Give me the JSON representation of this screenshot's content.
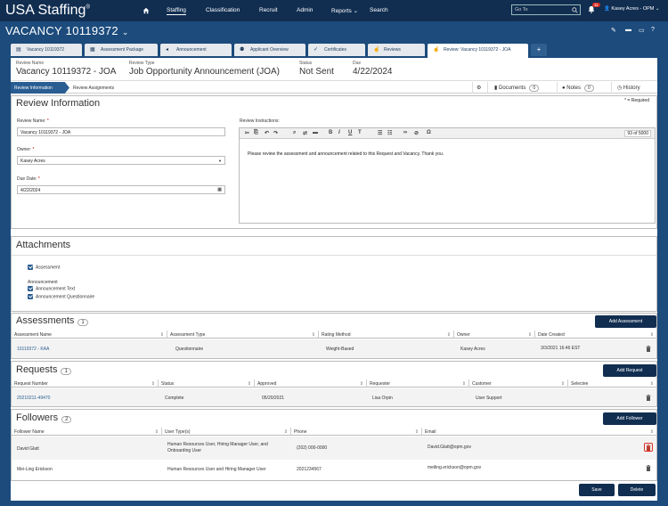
{
  "nav": {
    "logo": "USA Staffing",
    "items": [
      "Staffing",
      "Classification",
      "Recruit",
      "Admin",
      "Reports",
      "Search"
    ],
    "goto_placeholder": "Go To",
    "notif_count": "11",
    "user": "Kasey Acres - OPM"
  },
  "vacancy_title": "VACANCY 10119372",
  "tabs": [
    "Vacancy 10119372",
    "Assessment Package",
    "Announcement",
    "Applicant Overview",
    "Certificates",
    "Reviews",
    "Review: Vacancy 10119372 - JOA"
  ],
  "header": {
    "review_name_label": "Review Name",
    "review_name": "Vacancy 10119372 - JOA",
    "review_type_label": "Review Type",
    "review_type": "Job Opportunity Announcement (JOA)",
    "status_label": "Status",
    "status": "Not Sent",
    "due_label": "Due",
    "due": "4/22/2024"
  },
  "subtabs": {
    "info": "Review Information",
    "assign": "Review Assignments"
  },
  "actions": {
    "documents": "Documents",
    "documents_count": "0",
    "notes": "Notes",
    "notes_count": "0",
    "history": "History"
  },
  "review_info": {
    "title": "Review Information",
    "required_note": "* = Required",
    "name_label": "Review Name:",
    "name_value": "Vacancy 10119372 - JOA",
    "owner_label": "Owner:",
    "owner_value": "Kasey Acres",
    "due_label": "Due Date:",
    "due_value": "4/22/2024",
    "instructions_label": "Review Instructions:",
    "instructions_text": "Please review the assessment and announcement related to this Request and Vacancy. Thank you.",
    "char_count": "93 of 5000"
  },
  "attachments": {
    "title": "Attachments",
    "assessment": "Assessment",
    "announcement_group": "Announcement",
    "announcement_text": "Announcement Text",
    "announcement_q": "Announcement Questionnaire"
  },
  "assessments": {
    "title": "Assessments",
    "count": "1",
    "add": "Add Assessment",
    "columns": [
      "Assessment Name",
      "Assessment Type",
      "Rating Method",
      "Owner",
      "Date Created"
    ],
    "rows": [
      [
        "10119372 - KAA",
        "Questionnaire",
        "Weight-Based",
        "Kasey Acres",
        "3/3/2021 16:46 EST"
      ]
    ]
  },
  "requests": {
    "title": "Requests",
    "count": "1",
    "add": "Add Request",
    "columns": [
      "Request Number",
      "Status",
      "Approved",
      "Requester",
      "Customer",
      "Selectee"
    ],
    "rows": [
      [
        "20210211-49470",
        "Complete",
        "05/20/2021",
        "Lisa Orpin",
        "User Support",
        ""
      ]
    ]
  },
  "followers": {
    "title": "Followers",
    "count": "2",
    "add": "Add Follower",
    "columns": [
      "Follower Name",
      "User Type(s)",
      "Phone",
      "Email"
    ],
    "rows": [
      [
        "David Glatt",
        "Human Resources User, Hiring Manager User, and Onboarding User",
        "(202) 000-0000",
        "David.Glatt@opm.gov"
      ],
      [
        "Mei-Ling Erickson",
        "Human Resources User and Hiring Manager User",
        "2021234567",
        "meiling.erickson@opm.gov"
      ]
    ]
  },
  "footer": {
    "save": "Save",
    "delete": "Delete"
  }
}
